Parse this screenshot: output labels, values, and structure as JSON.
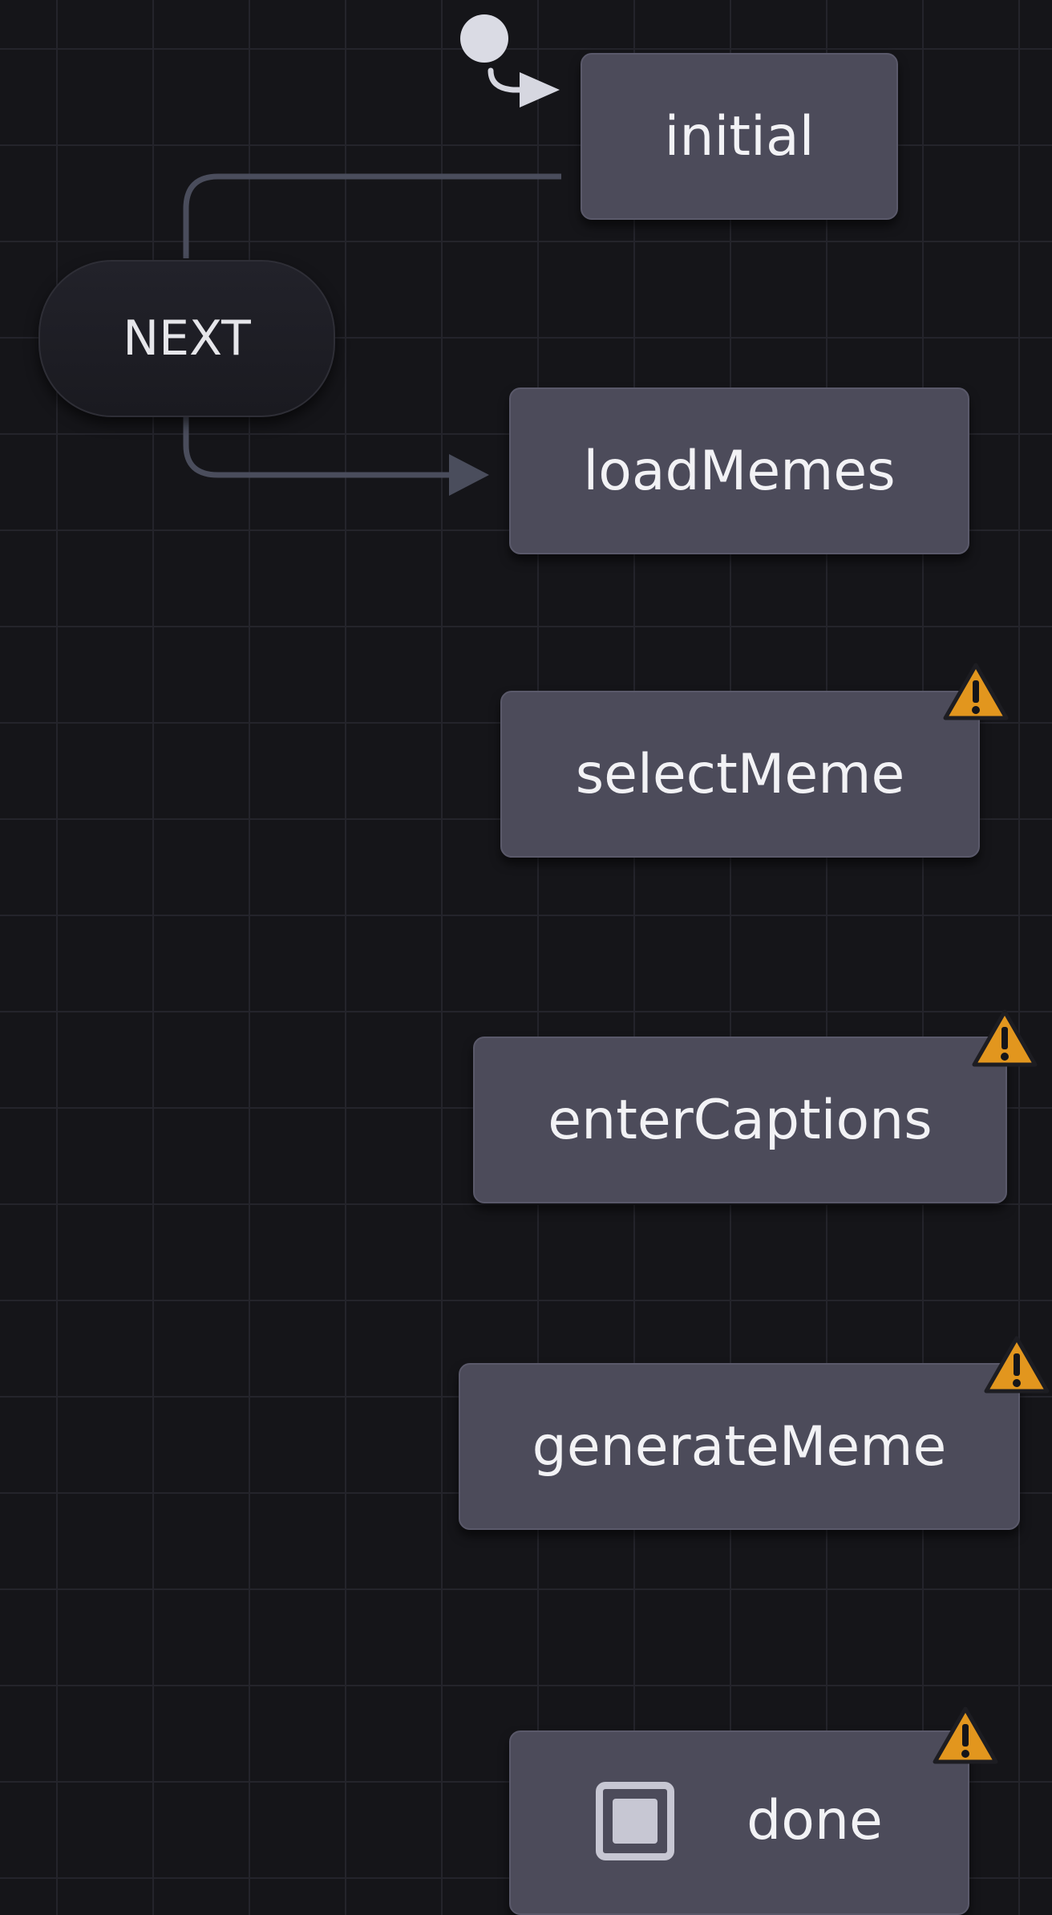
{
  "diagram": {
    "initial_marker": "initial-state-marker",
    "states": [
      {
        "id": "initial",
        "label": "initial",
        "warning": false
      },
      {
        "id": "loadMemes",
        "label": "loadMemes",
        "warning": false
      },
      {
        "id": "selectMeme",
        "label": "selectMeme",
        "warning": true
      },
      {
        "id": "enterCaptions",
        "label": "enterCaptions",
        "warning": true
      },
      {
        "id": "generateMeme",
        "label": "generateMeme",
        "warning": true
      },
      {
        "id": "done",
        "label": "done",
        "warning": true,
        "final": true
      }
    ],
    "events": [
      {
        "label": "NEXT",
        "from": "initial",
        "to": "loadMemes"
      }
    ]
  },
  "icons": {
    "warning": "warning-triangle-icon",
    "final": "final-state-icon"
  },
  "colors": {
    "background": "#151519",
    "grid": "#24242b",
    "state_fill": "#4c4b5a",
    "edge": "#4a4d5c",
    "warning": "#e2961e"
  }
}
